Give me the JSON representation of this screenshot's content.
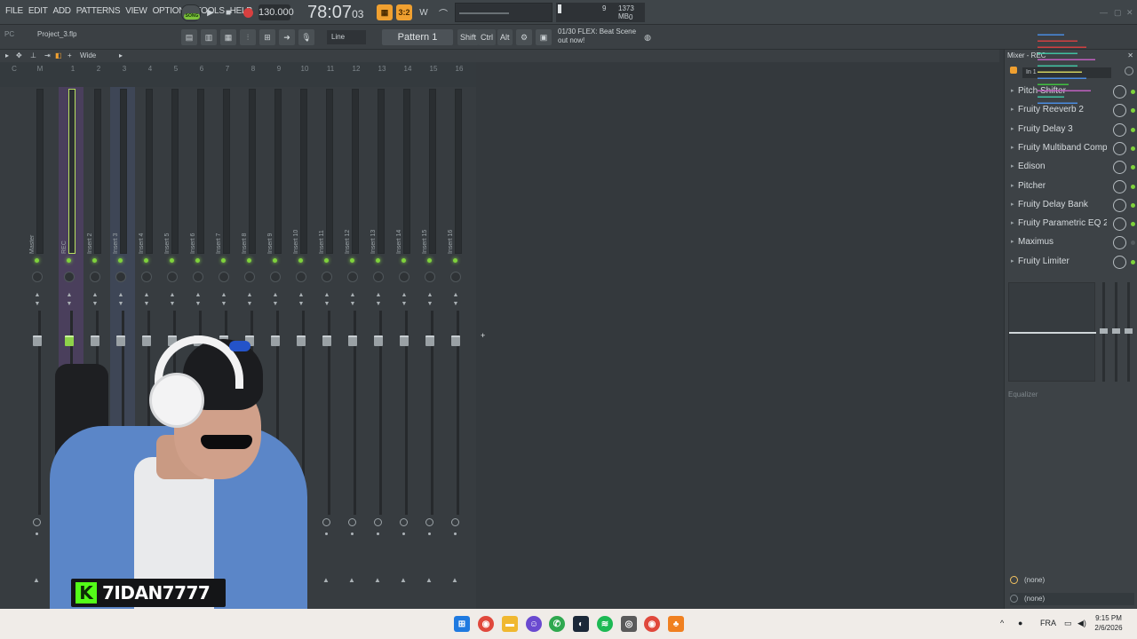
{
  "menu": [
    "FILE",
    "EDIT",
    "ADD",
    "PATTERNS",
    "VIEW",
    "OPTIONS",
    "TOOLS",
    "HELP"
  ],
  "transport": {
    "song_mode": "SONG",
    "tempo": "130.000",
    "time_main": "78:07",
    "time_sub": "03",
    "snap": "Line",
    "pattern": "Pattern 1"
  },
  "cpu": {
    "value": "9",
    "memory": "1373 MB",
    "voices": "0"
  },
  "news": {
    "line1": "01/30 FLEX: Beat Scene",
    "line2": "out now!"
  },
  "project": {
    "pc_label": "PC",
    "name": "Project_3.flp"
  },
  "modkeys": [
    "Shift",
    "Ctrl",
    "Alt"
  ],
  "mixer_toolbar": {
    "view": "Wide"
  },
  "mixer": {
    "columns": [
      "C",
      "M",
      "1",
      "2",
      "3",
      "4",
      "5",
      "6",
      "7",
      "8",
      "9",
      "10",
      "11",
      "12",
      "13",
      "14",
      "15",
      "16"
    ],
    "strips": [
      "Master",
      "REC",
      "Insert 2",
      "Insert 3",
      "Insert 4",
      "Insert 5",
      "Insert 6",
      "Insert 7",
      "Insert 8",
      "Insert 9",
      "Insert 10",
      "Insert 11",
      "Insert 12",
      "Insert 13",
      "Insert 14",
      "Insert 15",
      "Insert 16"
    ]
  },
  "mixer_panel": {
    "title": "Mixer - REC",
    "input": "In 1",
    "slots": [
      {
        "name": "Pitch Shifter",
        "on": true
      },
      {
        "name": "Fruity Reeverb 2",
        "on": true
      },
      {
        "name": "Fruity Delay 3",
        "on": true
      },
      {
        "name": "Fruity Multiband Compressor",
        "on": true
      },
      {
        "name": "Edison",
        "on": true
      },
      {
        "name": "Pitcher",
        "on": true
      },
      {
        "name": "Fruity Delay Bank",
        "on": true
      },
      {
        "name": "Fruity Parametric EQ 2",
        "on": true
      },
      {
        "name": "Maximus",
        "on": false
      },
      {
        "name": "Fruity Limiter",
        "on": true
      }
    ],
    "eq_label": "Equalizer",
    "route_in": "(none)",
    "route_out": "(none)"
  },
  "stream": {
    "platform_logo": "K",
    "username": "7IDAN7777"
  },
  "taskbar": {
    "language": "FRA",
    "time": "9:15 PM",
    "date": "2/6/2026"
  },
  "colors": {
    "accent_green": "#7fd23b",
    "kick_green": "#53fc18",
    "orange": "#f0a030"
  }
}
